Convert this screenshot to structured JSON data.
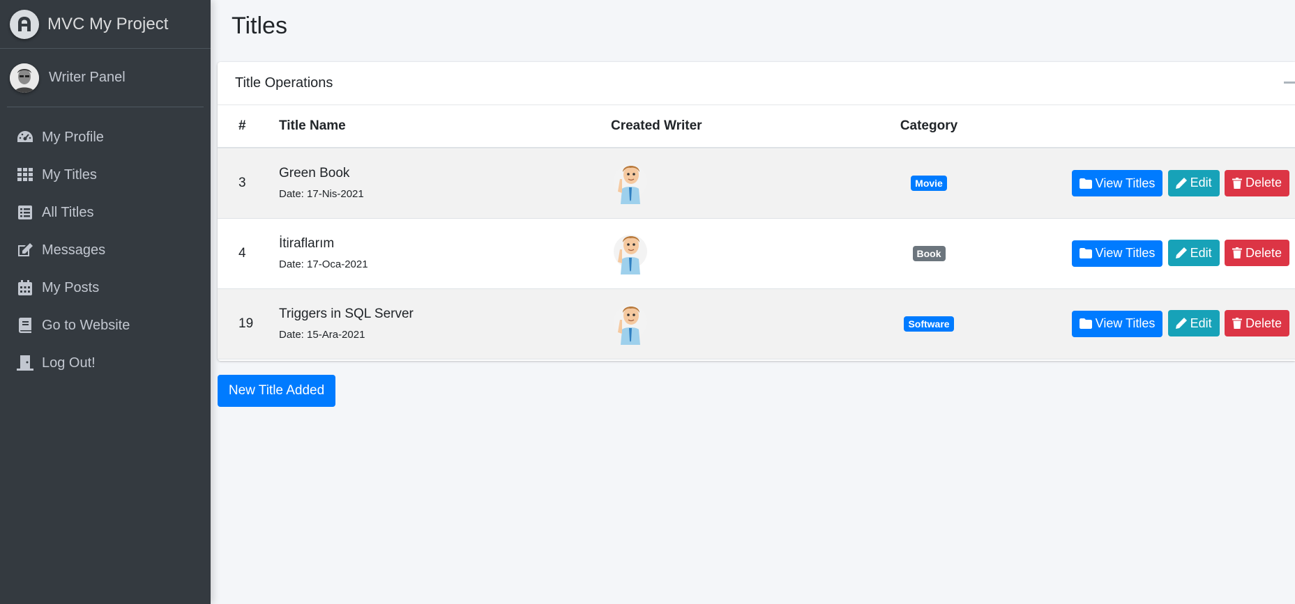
{
  "brand": {
    "title": "MVC My Project"
  },
  "user": {
    "name": "Writer Panel"
  },
  "nav": {
    "items": [
      {
        "label": "My Profile",
        "icon": "dashboard-icon"
      },
      {
        "label": "My Titles",
        "icon": "grid-icon"
      },
      {
        "label": "All Titles",
        "icon": "list-icon"
      },
      {
        "label": "Messages",
        "icon": "edit-icon"
      },
      {
        "label": "My Posts",
        "icon": "calendar-icon"
      },
      {
        "label": "Go to Website",
        "icon": "book-icon"
      },
      {
        "label": "Log Out!",
        "icon": "door-icon"
      }
    ]
  },
  "page": {
    "title": "Titles"
  },
  "card": {
    "title": "Title Operations"
  },
  "table": {
    "headers": [
      "#",
      "Title Name",
      "Created Writer",
      "Category",
      ""
    ],
    "rows": [
      {
        "id": "3",
        "name": "Green Book",
        "date": "Date: 17-Nis-2021",
        "category": "Movie",
        "category_color": "#007bff"
      },
      {
        "id": "4",
        "name": "İtiraflarım",
        "date": "Date: 17-Oca-2021",
        "category": "Book",
        "category_color": "#6c757d"
      },
      {
        "id": "19",
        "name": "Triggers in SQL Server",
        "date": "Date: 15-Ara-2021",
        "category": "Software",
        "category_color": "#007bff"
      }
    ]
  },
  "actions": {
    "view": "View Titles",
    "edit": "Edit",
    "delete": "Delete"
  },
  "new_button": {
    "label": "New Title Added"
  },
  "colors": {
    "sidebar": "#343a40",
    "primary": "#007bff",
    "info": "#17a2b8",
    "danger": "#dc3545",
    "secondary": "#6c757d"
  }
}
